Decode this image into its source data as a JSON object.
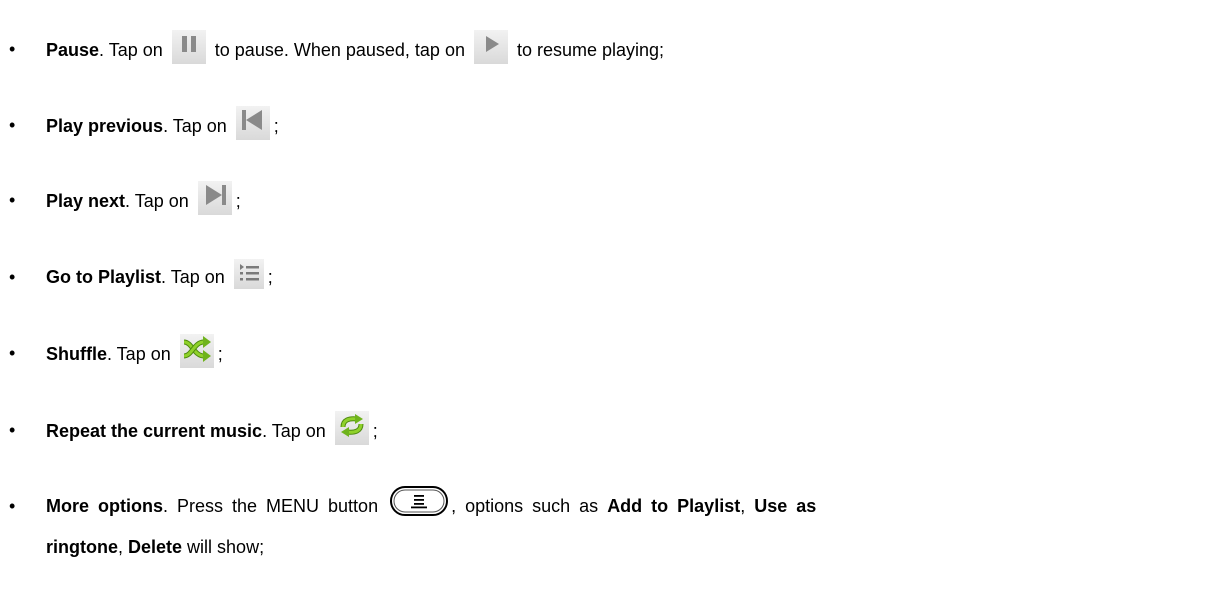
{
  "items": [
    {
      "title": "Pause",
      "t1": ". Tap on ",
      "t2": " to pause. When paused, tap on ",
      "t3": " to resume playing;"
    },
    {
      "title": "Play previous",
      "t1": ". Tap on ",
      "t2": ";"
    },
    {
      "title": "Play next",
      "t1": ". Tap on ",
      "t2": ";"
    },
    {
      "title": "Go to Playlist",
      "t1": ". Tap on ",
      "t2": ";"
    },
    {
      "title": "Shuffle",
      "t1": ". Tap on ",
      "t2": ";"
    },
    {
      "title": "Repeat the current music",
      "t1": ". Tap on ",
      "t2": ";"
    },
    {
      "title": "More options",
      "t1": ". Press the MENU button ",
      "t2": ", options such as ",
      "b1": "Add to Playlist",
      "t3": ", ",
      "b2": "Use as",
      "b3": "ringtone",
      "t4": ", ",
      "b4": "Delete",
      "t5": " will show;"
    }
  ],
  "icons": {
    "pause": "pause-icon",
    "play": "play-icon",
    "previous": "previous-icon",
    "next": "next-icon",
    "playlist": "playlist-icon",
    "shuffle": "shuffle-icon",
    "repeat": "repeat-icon",
    "menu": "menu-button-icon"
  },
  "colors": {
    "icon_gray": "#8a8a8a",
    "icon_green": "#7fbf1f",
    "icon_green_dark": "#4e8a10"
  }
}
